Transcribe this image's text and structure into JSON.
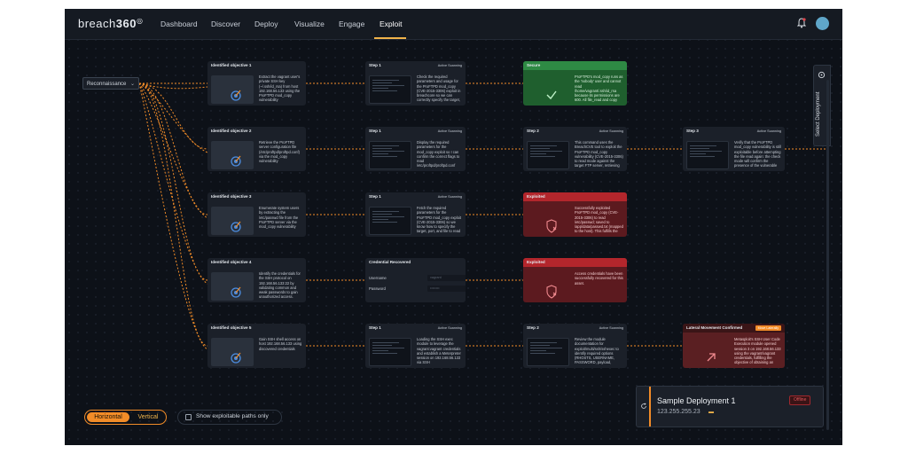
{
  "app": {
    "brand": "breach",
    "brand_bold": "360"
  },
  "nav": [
    {
      "label": "Dashboard",
      "active": false
    },
    {
      "label": "Discover",
      "active": false
    },
    {
      "label": "Deploy",
      "active": false
    },
    {
      "label": "Visualize",
      "active": false
    },
    {
      "label": "Engage",
      "active": false
    },
    {
      "label": "Exploit",
      "active": true
    }
  ],
  "icons": {
    "notifications": "bell-icon",
    "user": "avatar",
    "select_deployment": "gear-icon"
  },
  "colors": {
    "accent": "#f28c28",
    "secure": "#2e8a44",
    "exploited": "#b3262c",
    "background": "#0d1118"
  },
  "recon": {
    "label": "Reconnaissance"
  },
  "tags": {
    "active": "Active Scanning"
  },
  "objectives": [
    {
      "title": "Identified objective 1",
      "text": "Extract the vagrant user's private SSH key (~/.ssh/id_rsa) from host 192.168.56.133 using the ProFTPD mod_copy vulnerability"
    },
    {
      "title": "Identified objective 2",
      "text": "Retrieve the ProFTPD server configuration file (/etc/proftpd/proftpd.conf) via the mod_copy vulnerability"
    },
    {
      "title": "Identified objective 3",
      "text": "Enumerate system users by extracting the /etc/passwd file from the ProFTPD server via the mod_copy vulnerability"
    },
    {
      "title": "Identified objective 4",
      "text": "Identify the credentials for the SSH protocol on 192.168.56.133:22 by validating common and weak passwords to gain unauthorized access."
    },
    {
      "title": "Identified objective 5",
      "text": "Gain SSH shell access on host 192.168.56.133 using discovered credentials"
    }
  ],
  "steps": [
    {
      "title": "Step 1",
      "text": "Check the required parameters and usage for the ProFTPD mod_copy (CVE-2015-3306) exploit in breachcore so we can correctly specify the target, port, source file, and destination file fo..."
    },
    {
      "title": "Step 1",
      "text": "Display the required parameters for the mod_copy exploit so I can confirm the correct flags to read /etc/proftpd/proftpd.conf non-interactively before executing the actual file read."
    },
    {
      "title": "Step 1",
      "text": "Fetch the required parameters for the ProFTPD mod_copy exploit (CVE-2015-3306) so we know how to specify the target, port, and file to read (/etc/passwd) correctly before launching t..."
    },
    {
      "title": "Step 1",
      "text": "Loading the SSH exec module to leverage the vagrant:vagrant credentials and establish a Meterpreter session on 192.168.56.133 via SSH"
    }
  ],
  "step2": [
    {
      "title": "Step 2",
      "text": "This command uses the BreachCVE tool to exploit the ProFTPD mod_copy vulnerability (CVE-2015-3306) to read mode against the target FTP server, retrieving the /etc/proftpd.conf ..."
    },
    {
      "title": "Step 2",
      "text": "Review the module documentation for exploit/multi/ssh/sshexec to identify required options (RHOSTS, USERNAME, PASSWORD, payload, LHOST, etc.) before configuring and launching..."
    }
  ],
  "step3": {
    "title": "Step 3",
    "text": "Verify that the ProFTPD mod_copy vulnerability is still exploitable before attempting the file read again: the check mode will confirm the presence of the vulnerable directives and help di..."
  },
  "credential": {
    "title": "Credential Recovered",
    "username_label": "Username",
    "username_value": "vagrant",
    "password_label": "Password",
    "password_value": "••••••••"
  },
  "results": [
    {
      "status": "Secure",
      "text": "ProFTPD's mod_copy runs as the 'nobody' user and cannot read /home/vagrant/.ssh/id_rsa because its permissions are 600. All file_read and copy attempts failed with: No such file or ..."
    },
    {
      "status": "Exploited",
      "text": "Successfully exploited ProFTPD mod_copy (CVE-2015-3306) to read /etc/passwd; saved to /app/data/passwd.txt (mapped to the host). This fulfills the objective of enumerating syst..."
    },
    {
      "status": "Exploited",
      "text": "Access credentials have been successfully recovered for this asset."
    }
  ],
  "lateral": {
    "title": "Lateral Movement Confirmed",
    "badge": "Move Laterally",
    "text": "Metasploit's SSH User Code Execution module opened session 3 on 192.168.56.133 using the vagrant/vagrant credentials, fulfilling the objective of obtaining an SSH shell."
  },
  "side_panel": {
    "label": "Select Deployment"
  },
  "deployment": {
    "name": "Sample Deployment 1",
    "ip": "123.255.255.23",
    "flag": "▬",
    "status": "Offline"
  },
  "layout_toggle": {
    "options": [
      "Horizontal",
      "Vertical"
    ],
    "selected": "Horizontal"
  },
  "exploitable_only": {
    "label": "Show exploitable paths only",
    "checked": false
  }
}
